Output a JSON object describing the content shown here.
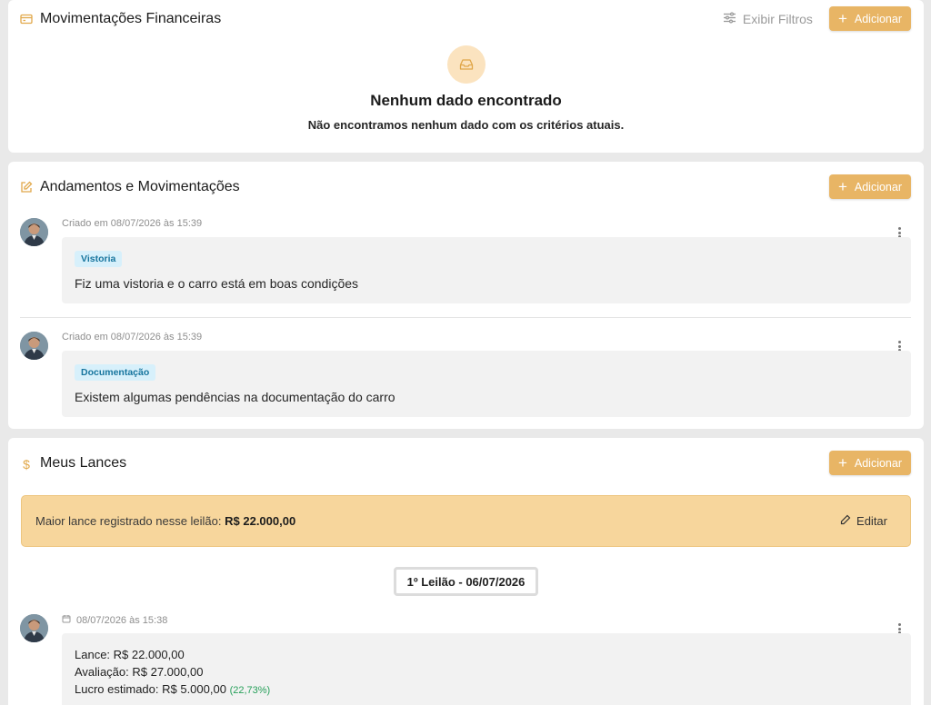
{
  "financial": {
    "title": "Movimentações Financeiras",
    "filter_label": "Exibir Filtros",
    "add_label": "Adicionar",
    "empty_title": "Nenhum dado encontrado",
    "empty_subtitle": "Não encontramos nenhum dado com os critérios atuais."
  },
  "progress": {
    "title": "Andamentos e Movimentações",
    "add_label": "Adicionar",
    "entries": [
      {
        "meta": "Criado em 08/07/2026 às 15:39",
        "tag": "Vistoria",
        "text": "Fiz uma vistoria e o carro está em boas condições"
      },
      {
        "meta": "Criado em 08/07/2026 às 15:39",
        "tag": "Documentação",
        "text": "Existem algumas pendências na documentação do carro"
      }
    ]
  },
  "bids": {
    "title": "Meus Lances",
    "add_label": "Adicionar",
    "highest_label": "Maior lance registrado nesse leilão:",
    "highest_value": "R$ 22.000,00",
    "edit_label": "Editar",
    "round_label": "1º Leilão - 06/07/2026",
    "entries": [
      {
        "meta": "08/07/2026 às 15:38",
        "bid": "Lance: R$ 22.000,00",
        "valuation": "Avaliação: R$ 27.000,00",
        "profit": "Lucro estimado: R$ 5.000,00",
        "profit_pct": "(22,73%)"
      }
    ]
  },
  "colors": {
    "accent": "#e8b565",
    "highlight_bg": "#f7d69c",
    "tag_bg": "#d7f0fb",
    "tag_text": "#17759e",
    "positive": "#27a05a"
  }
}
